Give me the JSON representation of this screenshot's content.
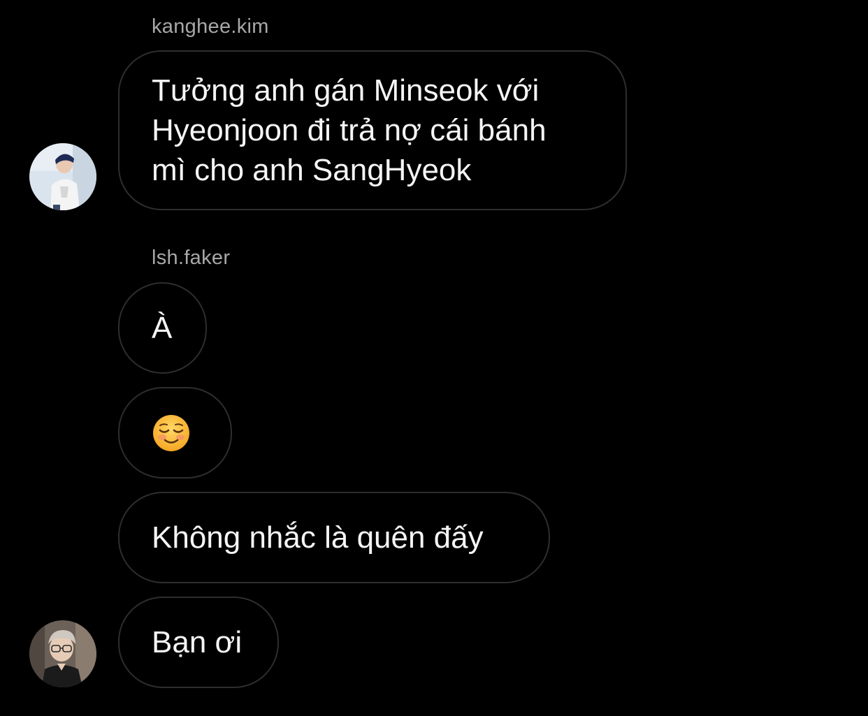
{
  "thread": {
    "groups": [
      {
        "sender": "kanghee.kim",
        "messages": [
          {
            "lines": [
              "Tưởng anh gán Minseok với",
              "Hyeonjoon đi trả nợ cái bánh",
              "mì cho anh SangHyeok"
            ]
          }
        ]
      },
      {
        "sender": "lsh.faker",
        "messages": [
          {
            "text": "À"
          },
          {
            "emoji": "smiling-face-emoji"
          },
          {
            "text": "Không nhắc là quên đấy"
          },
          {
            "text": "Bạn ơi"
          }
        ]
      }
    ]
  },
  "colors": {
    "background": "#000000",
    "bubble_border": "#2e2e2e",
    "sender_name": "#a8a8a8",
    "message_text": "#f5f5f5"
  }
}
